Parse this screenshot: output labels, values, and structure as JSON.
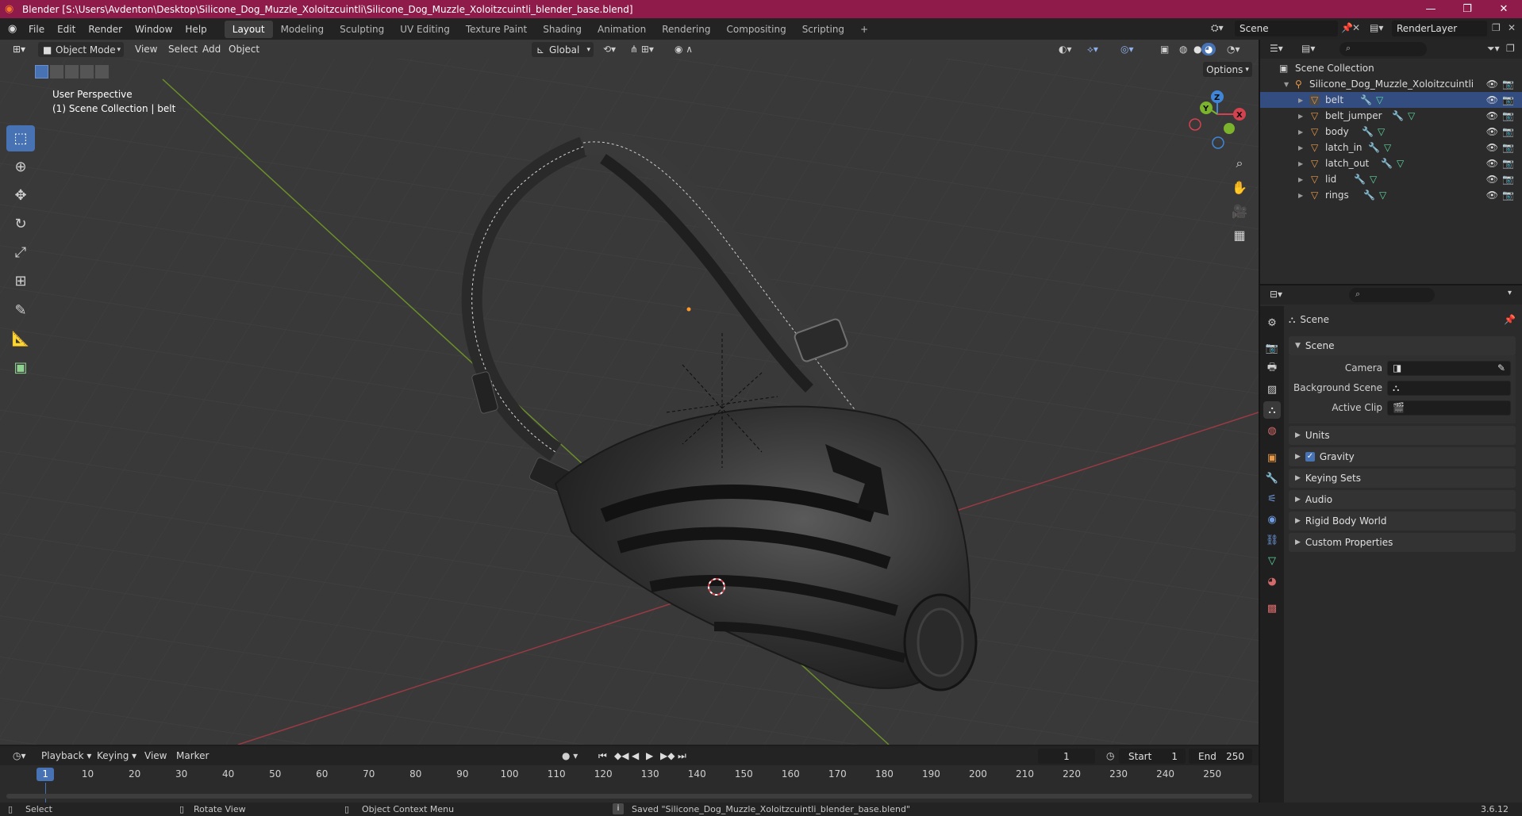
{
  "window": {
    "title": "Blender [S:\\Users\\Avdenton\\Desktop\\Silicone_Dog_Muzzle_Xoloitzcuintli\\Silicone_Dog_Muzzle_Xoloitzcuintli_blender_base.blend]",
    "controls": {
      "minimize": "—",
      "maximize": "❐",
      "close": "✕"
    }
  },
  "menubar": {
    "items": [
      "File",
      "Edit",
      "Render",
      "Window",
      "Help"
    ],
    "workspaces": [
      "Layout",
      "Modeling",
      "Sculpting",
      "UV Editing",
      "Texture Paint",
      "Shading",
      "Animation",
      "Rendering",
      "Compositing",
      "Scripting"
    ],
    "active_workspace": "Layout",
    "add_workspace": "+",
    "scene_name": "Scene",
    "render_layer": "RenderLayer"
  },
  "viewport": {
    "mode": "Object Mode",
    "menus": [
      "View",
      "Select",
      "Add",
      "Object"
    ],
    "transform_orientation": "Global",
    "options_label": "Options",
    "perspective_label": "User Perspective",
    "collection_label": "(1) Scene Collection | belt",
    "gizmo_axes": {
      "x": "X",
      "y": "Y",
      "z": "Z"
    }
  },
  "outliner": {
    "root": "Scene Collection",
    "collection": "Silicone_Dog_Muzzle_Xoloitzcuintli",
    "objects": [
      "belt",
      "belt_jumper",
      "body",
      "latch_in",
      "latch_out",
      "lid",
      "rings"
    ]
  },
  "properties": {
    "context": "Scene",
    "panel_scene": "Scene",
    "fields": [
      {
        "label": "Camera",
        "value": ""
      },
      {
        "label": "Background Scene",
        "value": ""
      },
      {
        "label": "Active Clip",
        "value": ""
      }
    ],
    "panels": [
      "Units",
      "Gravity",
      "Keying Sets",
      "Audio",
      "Rigid Body World",
      "Custom Properties"
    ],
    "gravity_checked": true
  },
  "timeline": {
    "menus": [
      "Playback",
      "Keying",
      "View",
      "Marker"
    ],
    "current_frame": "1",
    "start_label": "Start",
    "start_value": "1",
    "end_label": "End",
    "end_value": "250",
    "ruler": [
      "1",
      "10",
      "20",
      "30",
      "40",
      "50",
      "60",
      "70",
      "80",
      "90",
      "100",
      "110",
      "120",
      "130",
      "140",
      "150",
      "160",
      "170",
      "180",
      "190",
      "200",
      "210",
      "220",
      "230",
      "240",
      "250"
    ]
  },
  "statusbar": {
    "select": "Select",
    "rotate": "Rotate View",
    "context_menu": "Object Context Menu",
    "message": "Saved \"Silicone_Dog_Muzzle_Xoloitzcuintli_blender_base.blend\"",
    "version": "3.6.12"
  },
  "colors": {
    "title_bar": "#8f1b4b",
    "accent": "#4772b3",
    "object_icon": "#e89a4a",
    "axis_x": "#d4424f",
    "axis_y": "#7cb32c",
    "axis_z": "#3f86d8"
  }
}
